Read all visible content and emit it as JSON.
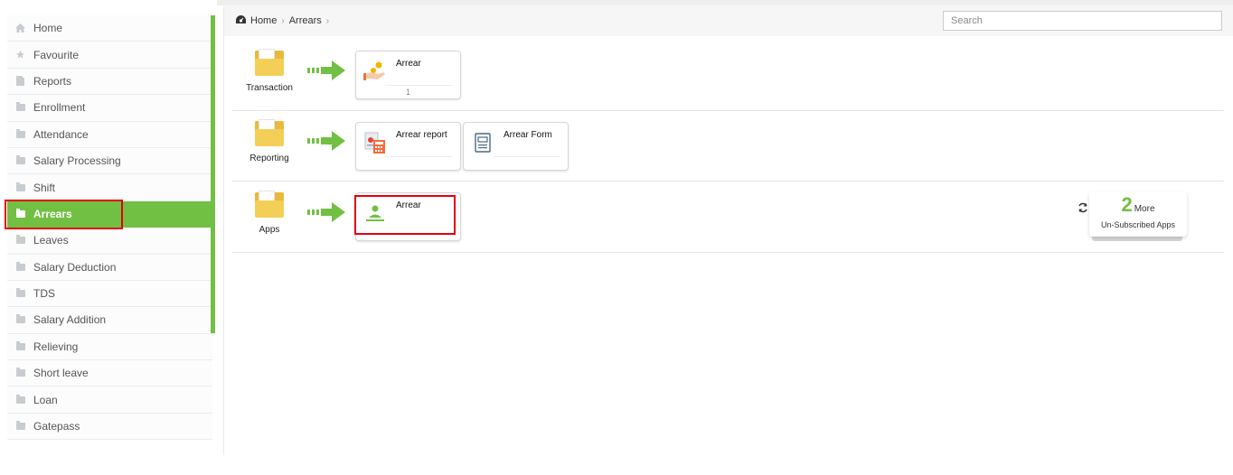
{
  "sidebar": {
    "items": [
      {
        "label": "Home",
        "icon": "home-icon"
      },
      {
        "label": "Favourite",
        "icon": "star-icon"
      },
      {
        "label": "Reports",
        "icon": "document-icon"
      },
      {
        "label": "Enrollment",
        "icon": "folder-icon"
      },
      {
        "label": "Attendance",
        "icon": "folder-icon"
      },
      {
        "label": "Salary Processing",
        "icon": "folder-icon"
      },
      {
        "label": "Shift",
        "icon": "folder-icon"
      },
      {
        "label": "Arrears",
        "icon": "folder-icon",
        "active": true
      },
      {
        "label": "Leaves",
        "icon": "folder-icon"
      },
      {
        "label": "Salary Deduction",
        "icon": "folder-icon"
      },
      {
        "label": "TDS",
        "icon": "folder-icon"
      },
      {
        "label": "Salary Addition",
        "icon": "folder-icon"
      },
      {
        "label": "Relieving",
        "icon": "folder-icon"
      },
      {
        "label": "Short leave",
        "icon": "folder-icon"
      },
      {
        "label": "Loan",
        "icon": "folder-icon"
      },
      {
        "label": "Gatepass",
        "icon": "folder-icon"
      }
    ]
  },
  "breadcrumb": {
    "home": "Home",
    "current": "Arrears",
    "separator": "›"
  },
  "search": {
    "placeholder": "Search",
    "value": ""
  },
  "sections": {
    "transaction": {
      "label": "Transaction",
      "cards": [
        {
          "title": "Arrear",
          "count": "1",
          "icon": "hand-coin-icon"
        }
      ]
    },
    "reporting": {
      "label": "Reporting",
      "cards": [
        {
          "title": "Arrear report",
          "icon": "report-calculator-icon"
        },
        {
          "title": "Arrear Form",
          "icon": "form-document-icon"
        }
      ]
    },
    "apps": {
      "label": "Apps",
      "cards": [
        {
          "title": "Arrear",
          "icon": "user-app-icon"
        }
      ]
    }
  },
  "more_apps": {
    "count": "2",
    "word": "More",
    "subtitle": "Un-Subscribed Apps"
  },
  "colors": {
    "accent": "#72c043",
    "highlight": "#e3000f",
    "folder": "#f3cf58"
  }
}
